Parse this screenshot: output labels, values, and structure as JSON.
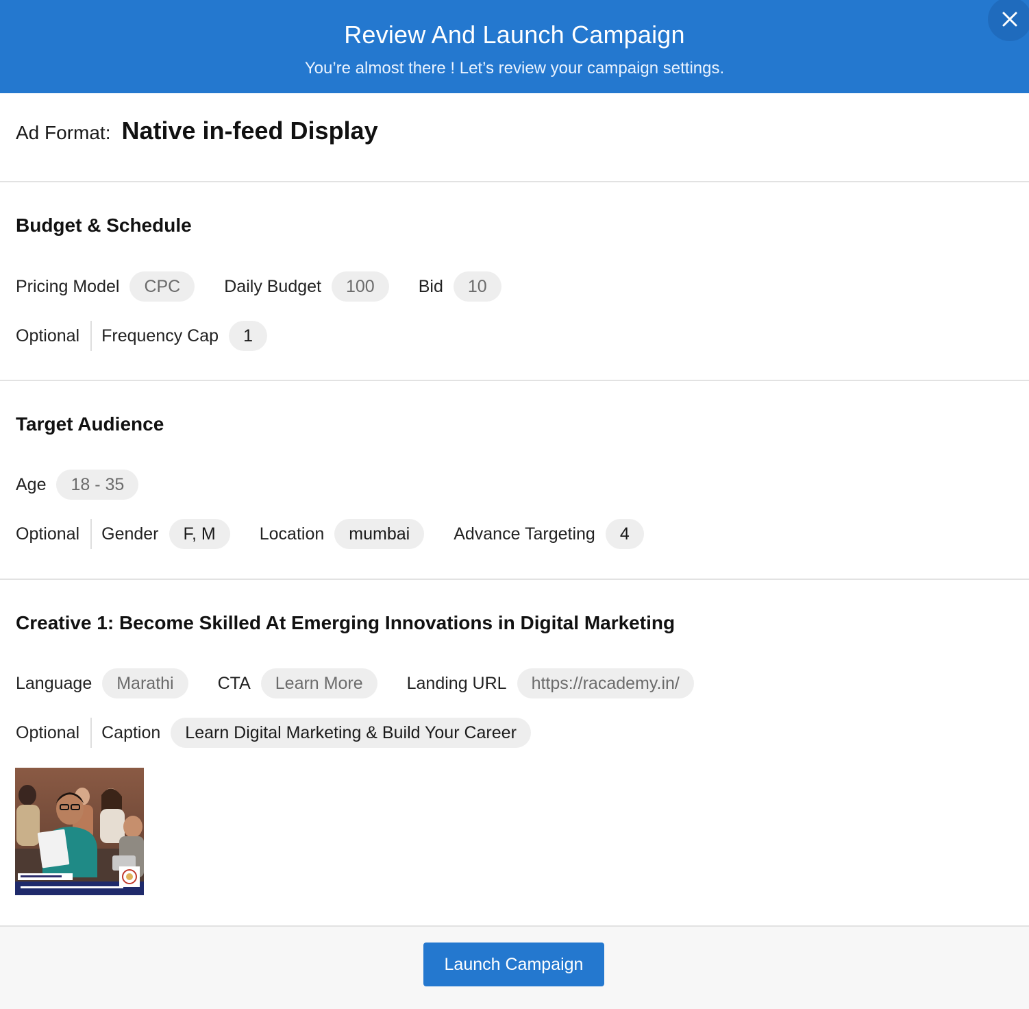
{
  "header": {
    "title": "Review And Launch Campaign",
    "subtitle": "You’re almost there ! Let’s review your campaign settings.",
    "close_icon": "close-icon"
  },
  "ad_format": {
    "label": "Ad Format:",
    "value": "Native in-feed Display"
  },
  "budget": {
    "title": "Budget & Schedule",
    "pricing_model_label": "Pricing Model",
    "pricing_model": "CPC",
    "daily_budget_label": "Daily Budget",
    "daily_budget": "100",
    "bid_label": "Bid",
    "bid": "10",
    "optional_label": "Optional",
    "frequency_cap_label": "Frequency Cap",
    "frequency_cap": "1"
  },
  "audience": {
    "title": "Target Audience",
    "age_label": "Age",
    "age": "18 - 35",
    "optional_label": "Optional",
    "gender_label": "Gender",
    "gender": "F, M",
    "location_label": "Location",
    "location": "mumbai",
    "advance_targeting_label": "Advance Targeting",
    "advance_targeting": "4"
  },
  "creative": {
    "title": "Creative 1: Become Skilled At Emerging Innovations in Digital Marketing",
    "language_label": "Language",
    "language": "Marathi",
    "cta_label": "CTA",
    "cta": "Learn More",
    "landing_url_label": "Landing URL",
    "landing_url": "https://racademy.in/",
    "optional_label": "Optional",
    "caption_label": "Caption",
    "caption": "Learn Digital Marketing & Build Your Career"
  },
  "footer": {
    "launch_label": "Launch Campaign"
  },
  "colors": {
    "primary": "#2478cf",
    "chip_bg": "#eeeeee",
    "divider": "#e2e2e2",
    "footer_bg": "#f7f7f7"
  }
}
